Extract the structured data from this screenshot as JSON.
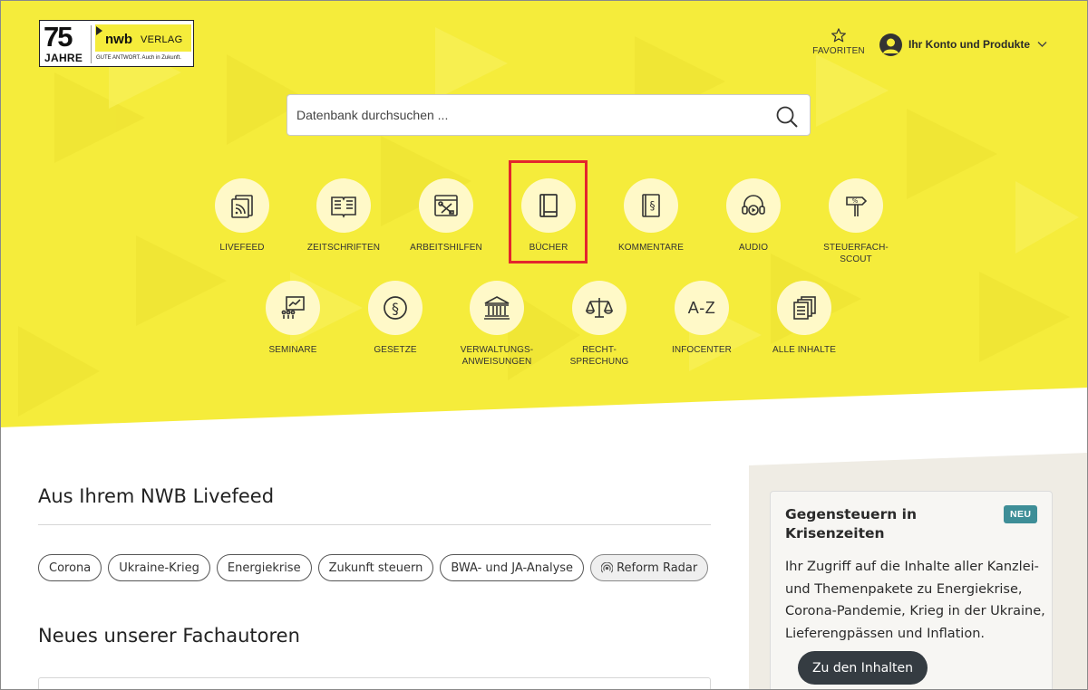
{
  "logo": {
    "years_number": "75",
    "years_word": "JAHRE",
    "brand": "nwb",
    "brand_suffix": "VERLAG",
    "tagline": "GUTE ANTWORT. Auch in Zukunft."
  },
  "header": {
    "favorites_label": "FAVORITEN",
    "account_label": "Ihr Konto und Produkte"
  },
  "search": {
    "placeholder": "Datenbank durchsuchen ..."
  },
  "tiles_row1": [
    {
      "label": "LIVEFEED",
      "icon": "livefeed-icon"
    },
    {
      "label": "ZEITSCHRIFTEN",
      "icon": "magazine-icon"
    },
    {
      "label": "ARBEITSHILFEN",
      "icon": "tools-icon"
    },
    {
      "label": "BÜCHER",
      "icon": "book-icon"
    },
    {
      "label": "KOMMENTARE",
      "icon": "commentary-icon"
    },
    {
      "label": "AUDIO",
      "icon": "headphones-icon"
    },
    {
      "label": "STEUERFACH-\nSCOUT",
      "icon": "signpost-icon"
    }
  ],
  "tiles_row2": [
    {
      "label": "SEMINARE",
      "icon": "seminar-icon"
    },
    {
      "label": "GESETZE",
      "icon": "paragraph-icon"
    },
    {
      "label": "VERWALTUNGS-\nANWEISUNGEN",
      "icon": "building-icon"
    },
    {
      "label": "RECHT-\nSPRECHUNG",
      "icon": "scales-icon"
    },
    {
      "label": "INFOCENTER",
      "icon": "az-icon",
      "glyph": "A-Z"
    },
    {
      "label": "ALLE INHALTE",
      "icon": "documents-icon"
    }
  ],
  "livefeed": {
    "heading": "Aus Ihrem NWB Livefeed",
    "tags": [
      "Corona",
      "Ukraine-Krieg",
      "Energiekrise",
      "Zukunft steuern",
      "BWA- und JA-Analyse",
      "Reform Radar"
    ]
  },
  "authors": {
    "heading": "Neues unserer Fachautoren"
  },
  "promo": {
    "title": "Gegensteuern in Krisenzeiten",
    "badge": "NEU",
    "text": "Ihr Zugriff auf die Inhalte aller Kanzlei- und Themenpakete zu Energiekrise, Corona-Pandemie, Krieg in der Ukraine, Lieferengpässen und Inflation.",
    "button": "Zu den Inhalten"
  },
  "colors": {
    "hero_yellow": "#f5ec3b",
    "tile_circle": "#fff9c8",
    "highlight_red": "#e3262d",
    "badge_teal": "#3e8e97",
    "button_dark": "#353c42"
  }
}
